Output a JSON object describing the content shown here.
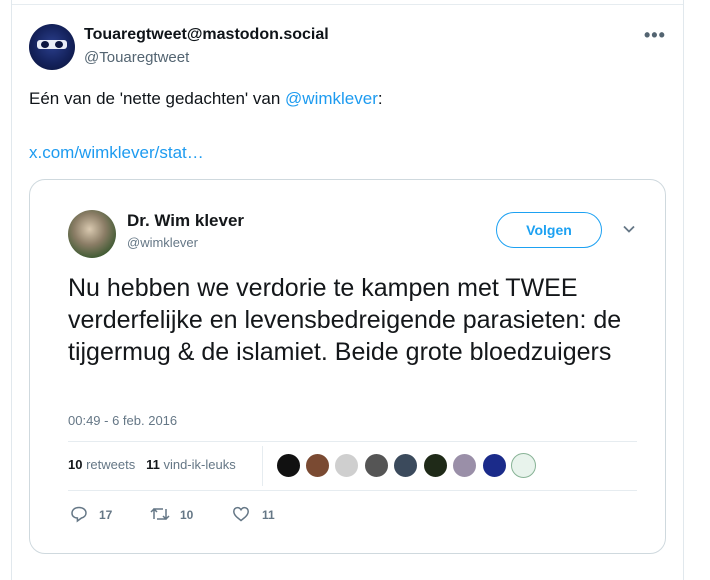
{
  "post": {
    "display_name": "Touaregtweet@mastodon.social",
    "handle": "@Touaregtweet",
    "text_before": "Eén van de 'nette gedachten' van ",
    "mention": "@wimklever",
    "text_after": ":",
    "link": "x.com/wimklever/stat…"
  },
  "embed": {
    "display_name": "Dr. Wim klever",
    "handle": "@wimklever",
    "follow_label": "Volgen",
    "body": "Nu hebben we verdorie te kampen met TWEE verderfelijke en levensbedreigende parasieten: de tijgermug & de islamiet. Beide grote bloedzuigers",
    "timestamp": "00:49 - 6 feb. 2016",
    "retweets_count": "10",
    "retweets_label": "retweets",
    "likes_count": "11",
    "likes_label": "vind-ik-leuks",
    "replies": "17",
    "retweet_action": "10",
    "like_action": "11"
  },
  "colors": {
    "accent": "#1d9bf0",
    "follow": "#1da1f2"
  }
}
